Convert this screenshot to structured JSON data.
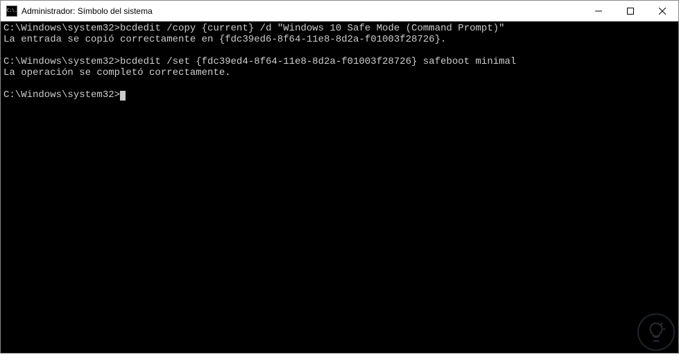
{
  "window": {
    "title": "Administrador: Símbolo del sistema",
    "icon_label": "C:\\."
  },
  "controls": {
    "minimize": "minimize",
    "maximize": "maximize",
    "close": "close"
  },
  "terminal": {
    "lines": [
      {
        "prompt": "C:\\Windows\\system32>",
        "command": "bcdedit /copy {current} /d \"Windows 10 Safe Mode (Command Prompt)\""
      },
      {
        "text": "La entrada se copió correctamente en {fdc39ed6-8f64-11e8-8d2a-f01003f28726}."
      },
      {
        "text": ""
      },
      {
        "prompt": "C:\\Windows\\system32>",
        "command": "bcdedit /set {fdc39ed4-8f64-11e8-8d2a-f01003f28726} safeboot minimal"
      },
      {
        "text": "La operación se completó correctamente."
      },
      {
        "text": ""
      },
      {
        "prompt": "C:\\Windows\\system32>",
        "command": "",
        "cursor": true
      }
    ]
  }
}
